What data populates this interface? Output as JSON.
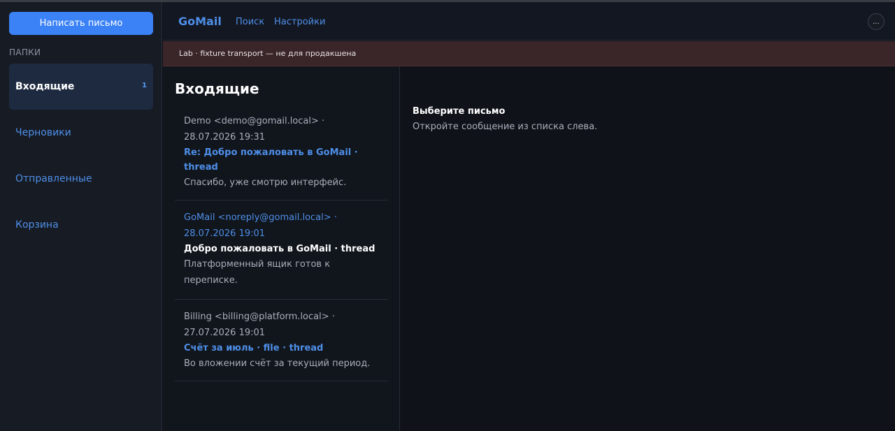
{
  "sidebar": {
    "compose_label": "Написать письмо",
    "folders_heading": "ПАПКИ",
    "folders": [
      {
        "label": "Входящие",
        "badge": "1"
      },
      {
        "label": "Черновики"
      },
      {
        "label": "Отправленные"
      },
      {
        "label": "Корзина"
      }
    ]
  },
  "header": {
    "brand": "GoMail",
    "nav": [
      "Поиск",
      "Настройки"
    ],
    "menu_label": "..."
  },
  "banner": {
    "text": "Lab · fixture transport — не для продакшена"
  },
  "list": {
    "title": "Входящие",
    "messages": [
      {
        "from": "Demo <demo@gomail.local> ·",
        "date": "28.07.2026 19:31",
        "subject_line1": "Re: Добро пожаловать в GoMail ·",
        "subject_line2": "thread",
        "snippet": "Спасибо, уже смотрю интерфейс."
      },
      {
        "from": "GoMail <noreply@gomail.local> ·",
        "date": "28.07.2026 19:01",
        "subject": "Добро пожаловать в GoMail · thread",
        "snippet_line1": "Платформенный ящик готов к",
        "snippet_line2": "переписке."
      },
      {
        "from": "Billing <billing@platform.local> ·",
        "date": "27.07.2026 19:01",
        "subject": "Счёт за июль · file · thread",
        "snippet": "Во вложении счёт за текущий период."
      }
    ]
  },
  "reading_pane": {
    "title": "Выберите письмо",
    "text": "Откройте сообщение из списка слева."
  },
  "colors": {
    "accent": "#3b82f6",
    "link": "#4e8fe8",
    "banner_bg": "#3a2528",
    "sidebar_bg": "#171b24",
    "active_folder_bg": "#1d2a40"
  }
}
